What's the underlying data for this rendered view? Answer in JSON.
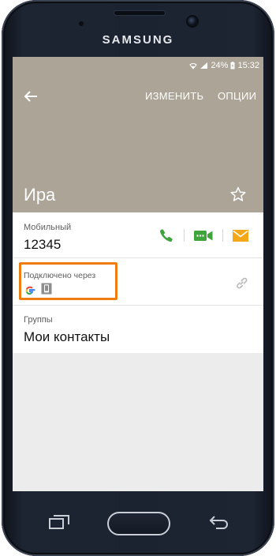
{
  "device": {
    "brand": "SAMSUNG"
  },
  "status_bar": {
    "battery": "24%",
    "time": "15:32"
  },
  "header": {
    "edit_label": "ИЗМЕНИТЬ",
    "options_label": "ОПЦИИ",
    "contact_name": "Ира"
  },
  "phone_section": {
    "label": "Мобильный",
    "number": "12345"
  },
  "connected_section": {
    "label": "Подключено через"
  },
  "groups_section": {
    "label": "Группы",
    "value": "Мои контакты"
  },
  "colors": {
    "header_bg": "#aca597",
    "call_green": "#3fa43c",
    "video_green": "#3fa43c",
    "message_orange": "#f2a818",
    "highlight_orange": "#f07c14"
  },
  "icons": [
    "back-arrow-icon",
    "star-icon",
    "phone-icon",
    "video-call-icon",
    "message-icon",
    "google-icon",
    "device-icon",
    "link-icon",
    "recent-apps-icon",
    "back-key-icon"
  ]
}
